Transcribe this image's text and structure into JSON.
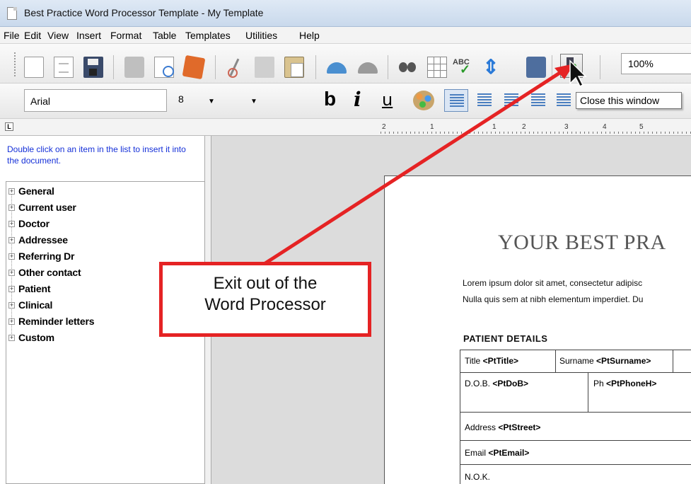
{
  "window": {
    "title": "Best Practice Word Processor Template - My Template",
    "icon": "document-icon"
  },
  "menubar": {
    "items": [
      "File",
      "Edit",
      "View",
      "Insert",
      "Format",
      "Table",
      "Templates",
      "Utilities",
      "Help"
    ]
  },
  "toolbar": {
    "icons": [
      "new-document-icon",
      "open-document-icon",
      "save-icon",
      "print-icon",
      "print-preview-icon",
      "export-icon",
      "cut-icon",
      "copy-icon",
      "paste-icon",
      "undo-icon",
      "redo-icon",
      "find-icon",
      "insert-table-icon",
      "spell-check-icon",
      "move-up-down-icon",
      "contact-icon",
      "close-window-icon"
    ],
    "zoom": "100%"
  },
  "formatting": {
    "font": "Arial",
    "size": "8",
    "bold": "b",
    "italic": "i",
    "underline": "u",
    "color_icon": "color-palette-icon",
    "tooltip": "Close this window"
  },
  "ruler": {
    "labels": [
      "2",
      "1",
      "1",
      "2",
      "3",
      "4",
      "5"
    ]
  },
  "sidebar": {
    "hint": "Double click on an item in the list to insert it into the document.",
    "items": [
      {
        "label": "General"
      },
      {
        "label": "Current user"
      },
      {
        "label": "Doctor"
      },
      {
        "label": "Addressee"
      },
      {
        "label": "Referring Dr"
      },
      {
        "label": "Other contact"
      },
      {
        "label": "Patient"
      },
      {
        "label": "Clinical"
      },
      {
        "label": "Reminder letters"
      },
      {
        "label": "Custom"
      }
    ]
  },
  "document": {
    "heading": "YOUR BEST PRA",
    "lorem_line1": "Lorem ipsum dolor sit amet, consectetur adipisc",
    "lorem_line2": "Nulla quis sem at nibh elementum imperdiet. Du",
    "section": "PATIENT DETAILS",
    "rows": {
      "title_label": "Title ",
      "title_field": "<PtTitle>",
      "surname_label": "Surname ",
      "surname_field": "<PtSurname>",
      "dob_label": "D.O.B. ",
      "dob_field": "<PtDoB>",
      "ph_label": "Ph ",
      "ph_field": "<PtPhoneH>",
      "address_label": "Address ",
      "address_field": "<PtStreet>",
      "email_label": "Email ",
      "email_field": "<PtEmail>",
      "nok_label": "N.O.K."
    }
  },
  "annotation": {
    "text_line1": "Exit out of the",
    "text_line2": "Word Processor",
    "color": "#e52324"
  }
}
